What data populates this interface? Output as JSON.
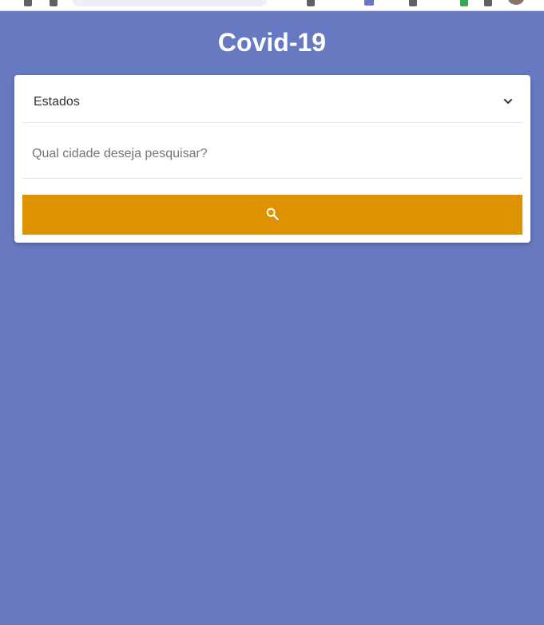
{
  "header": {
    "title": "Covid-19"
  },
  "form": {
    "state_select": {
      "selected_label": "Estados",
      "icon": "chevron-down-icon"
    },
    "city_input": {
      "value": "",
      "placeholder": "Qual cidade deseja pesquisar?"
    },
    "search_button": {
      "icon": "search-icon"
    }
  },
  "colors": {
    "background": "#677ac1",
    "card": "#ffffff",
    "button": "#df9200",
    "title_text": "#ffffff"
  }
}
